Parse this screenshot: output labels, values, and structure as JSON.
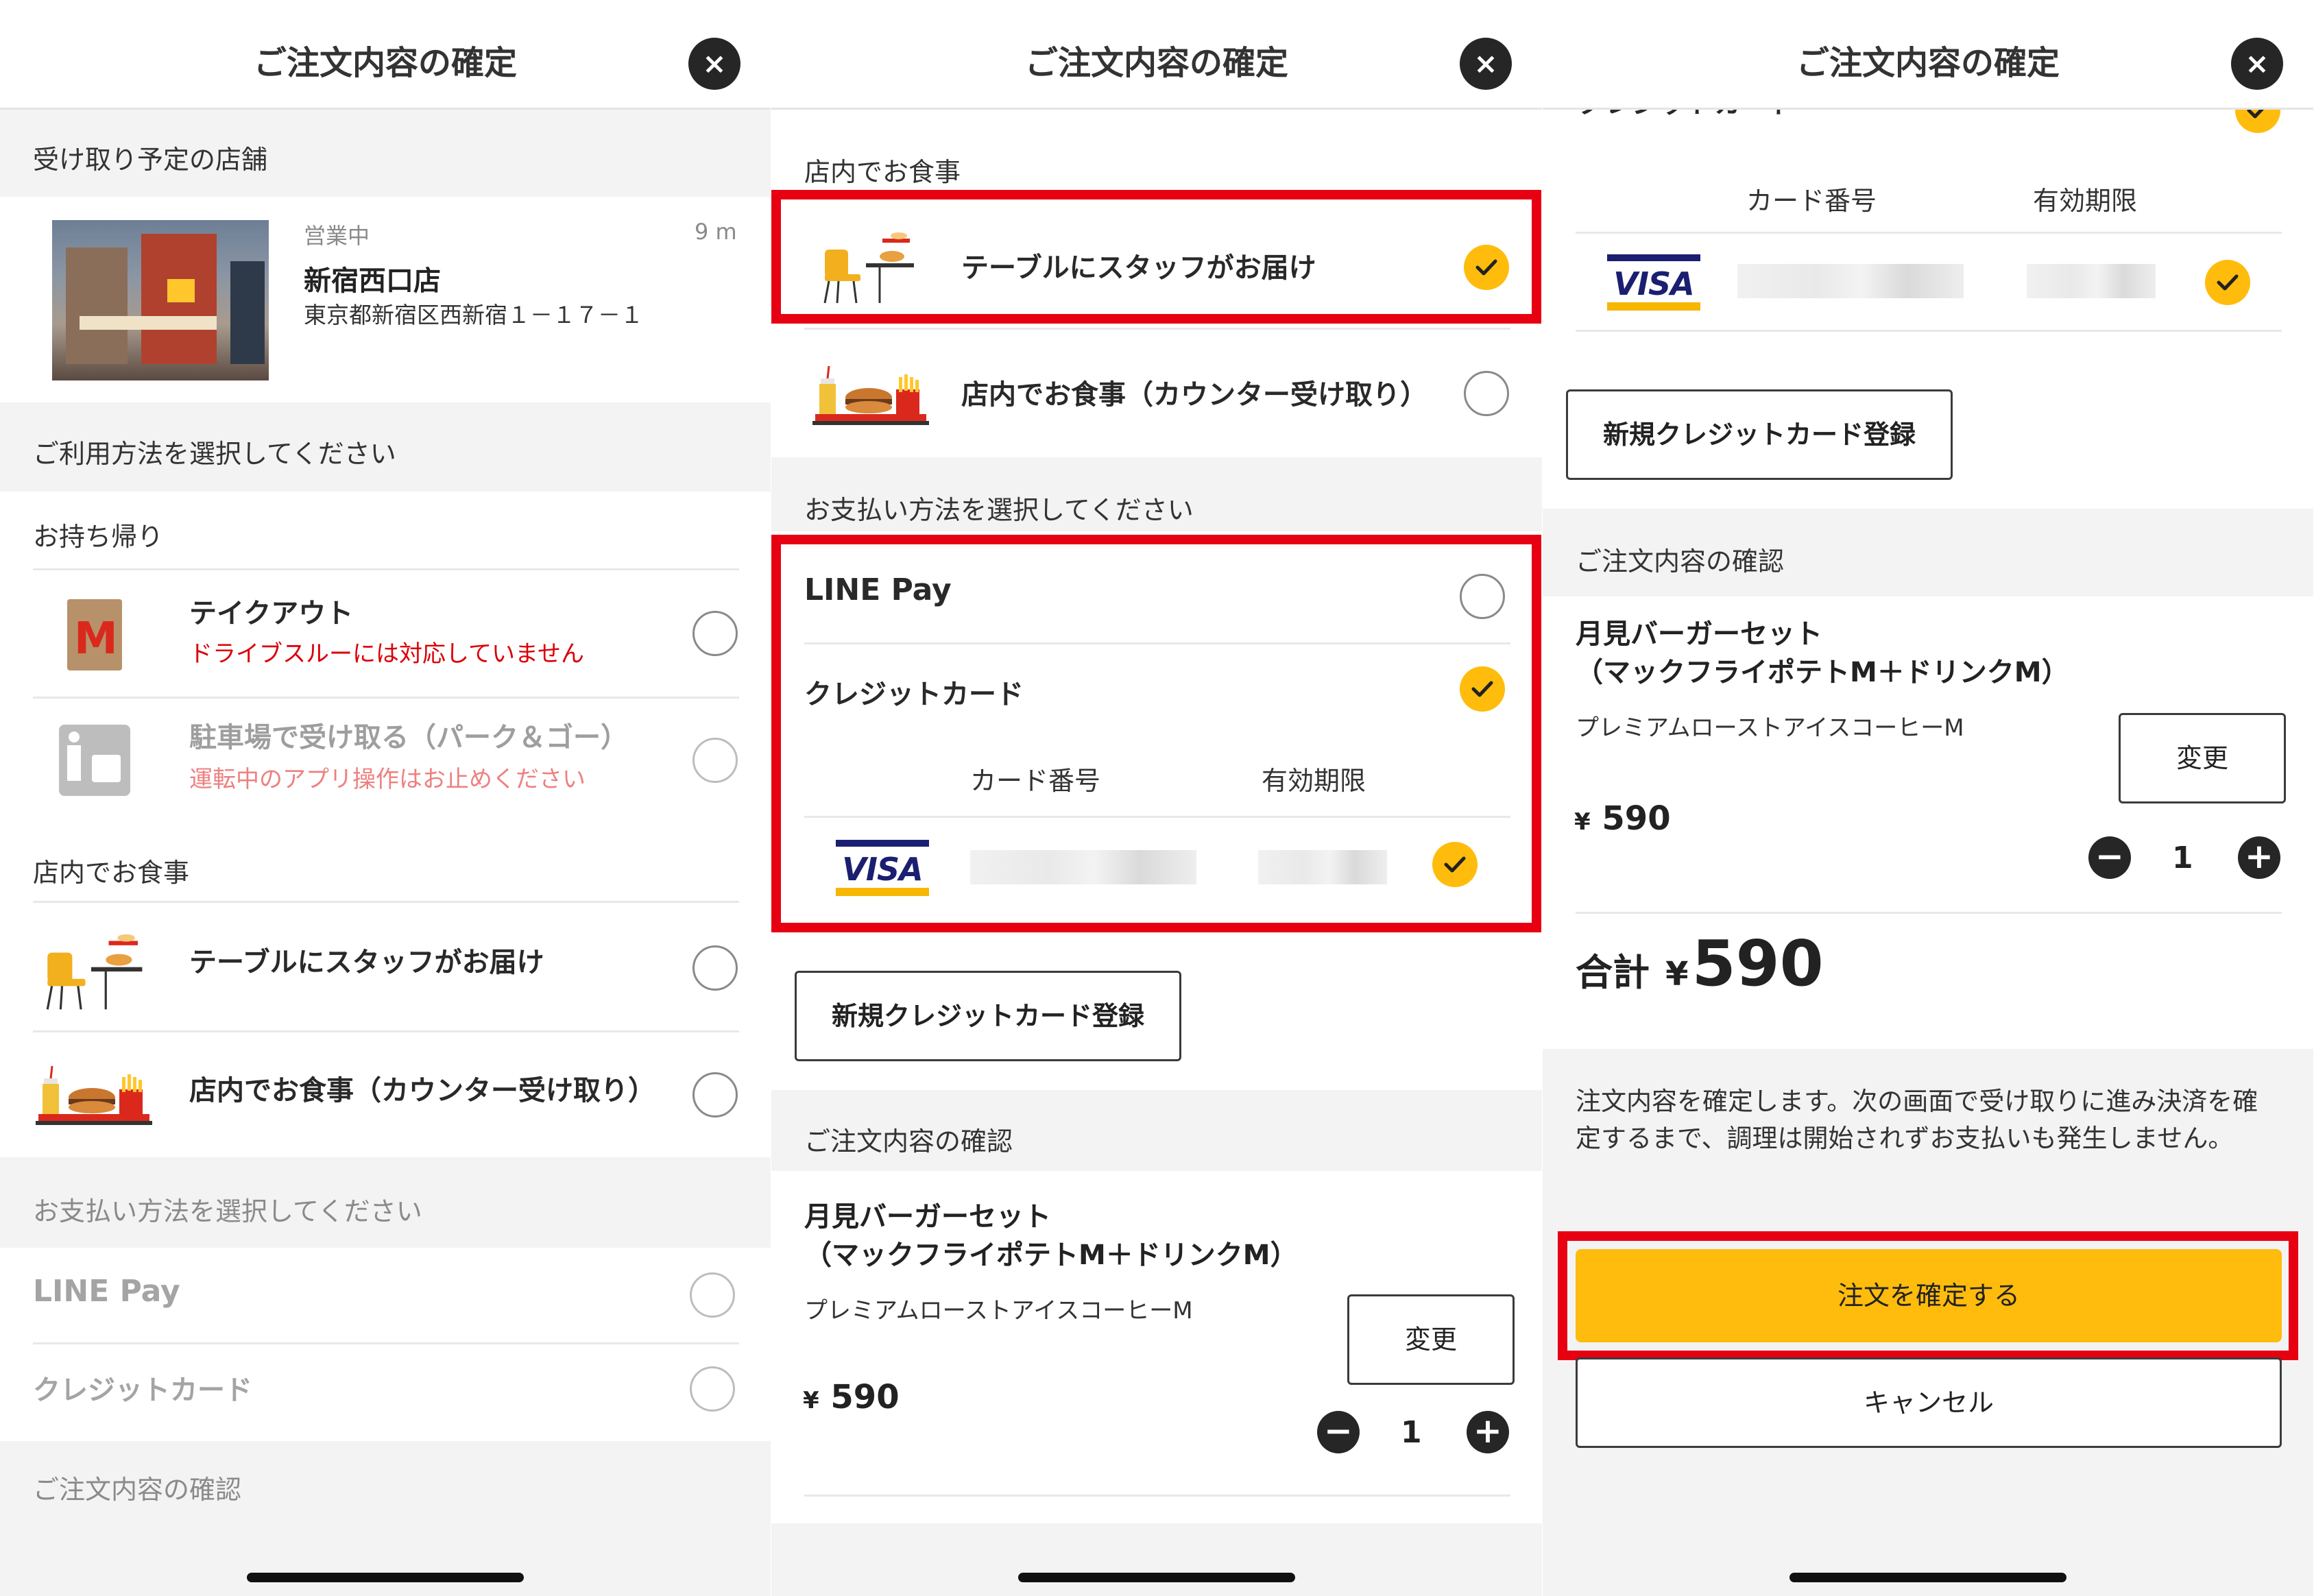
{
  "header": {
    "title": "ご注文内容の確定",
    "close_icon": "×"
  },
  "store": {
    "section_label": "受け取り予定の店舗",
    "status": "営業中",
    "distance": "9 m",
    "name": "新宿西口店",
    "address": "東京都新宿区西新宿１－１７－１"
  },
  "usage": {
    "section_label": "ご利用方法を選択してください",
    "takeout_group": "お持ち帰り",
    "takeout": {
      "title": "テイクアウト",
      "note": "ドライブスルーには対応していません"
    },
    "park": {
      "title": "駐車場で受け取る（パーク＆ゴー）",
      "note": "運転中のアプリ操作はお止めください"
    },
    "dinein_group": "店内でお食事",
    "table": {
      "title": "テーブルにスタッフがお届け"
    },
    "counter": {
      "title": "店内でお食事（カウンター受け取り）"
    }
  },
  "payment": {
    "section_label": "お支払い方法を選択してください",
    "linepay": "LINE Pay",
    "credit": "クレジットカード",
    "col_card_number": "カード番号",
    "col_expiry": "有効期限",
    "card_brand": "VISA",
    "new_card_button": "新規クレジットカード登録"
  },
  "order": {
    "section_label": "ご注文内容の確認",
    "item_title_1": "月見バーガーセット",
    "item_title_2": "（マックフライポテトM＋ドリンクM）",
    "item_sub": "プレミアムローストアイスコーヒーM",
    "change_button": "変更",
    "yen": "¥",
    "price": "590",
    "quantity": "1",
    "minus": "−",
    "plus": "+",
    "total_label": "合計",
    "total_value": "590"
  },
  "confirm": {
    "notice": "注文内容を確定します。次の画面で受け取りに進み決済を確定するまで、調理は開始されずお支払いも発生しません。",
    "confirm_button": "注文を確定する",
    "cancel_button": "キャンセル"
  },
  "colors": {
    "accent": "#ffbc0d",
    "highlight": "#e60012",
    "warning_text": "#db0007",
    "mcd_red": "#da291c"
  }
}
